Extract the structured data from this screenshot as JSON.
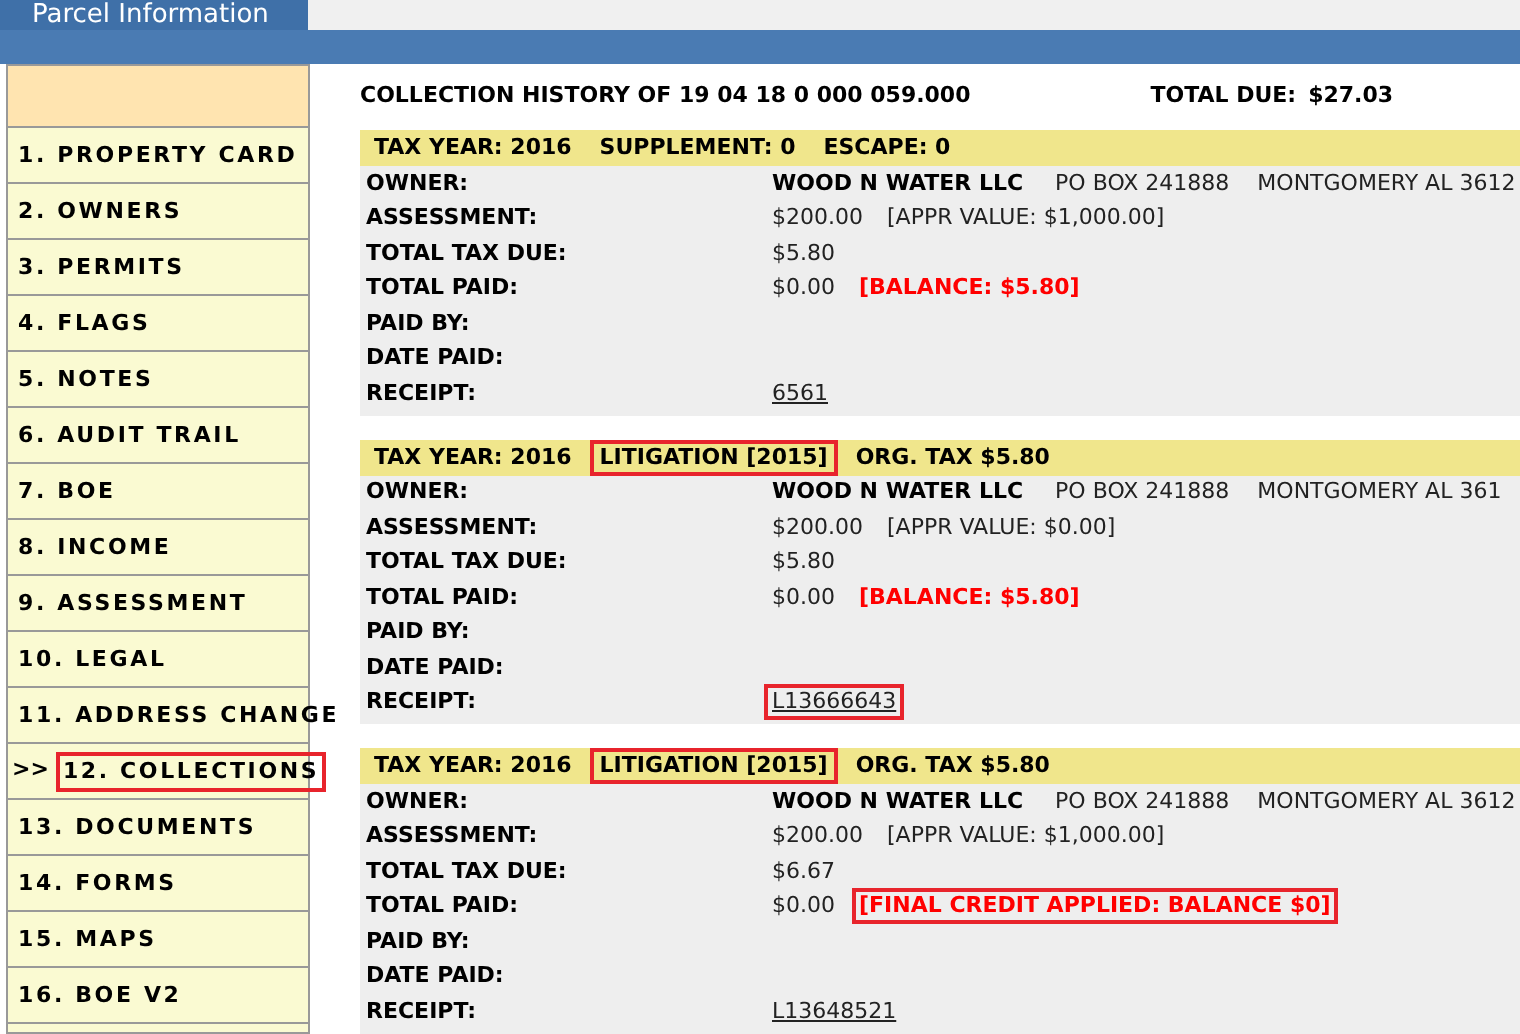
{
  "tab": {
    "label": "Parcel Information"
  },
  "sidebar": {
    "pointer": ">>",
    "items": [
      {
        "label": "1. PROPERTY CARD",
        "selected": false,
        "highlighted": false
      },
      {
        "label": "2. OWNERS",
        "selected": false,
        "highlighted": false
      },
      {
        "label": "3. PERMITS",
        "selected": false,
        "highlighted": false
      },
      {
        "label": "4. FLAGS",
        "selected": false,
        "highlighted": false
      },
      {
        "label": "5. NOTES",
        "selected": false,
        "highlighted": false
      },
      {
        "label": "6. AUDIT TRAIL",
        "selected": false,
        "highlighted": false
      },
      {
        "label": "7. BOE",
        "selected": false,
        "highlighted": false
      },
      {
        "label": "8. INCOME",
        "selected": false,
        "highlighted": false
      },
      {
        "label": "9. ASSESSMENT",
        "selected": false,
        "highlighted": false
      },
      {
        "label": "10. LEGAL",
        "selected": false,
        "highlighted": false
      },
      {
        "label": "11. ADDRESS CHANGE",
        "selected": false,
        "highlighted": false
      },
      {
        "label": "12. COLLECTIONS",
        "selected": true,
        "highlighted": true
      },
      {
        "label": "13. DOCUMENTS",
        "selected": false,
        "highlighted": false
      },
      {
        "label": "14. FORMS",
        "selected": false,
        "highlighted": false
      },
      {
        "label": "15. MAPS",
        "selected": false,
        "highlighted": false
      },
      {
        "label": "16. BOE V2",
        "selected": false,
        "highlighted": false
      }
    ]
  },
  "heading": {
    "title": "COLLECTION HISTORY OF 19 04 18 0 000 059.000",
    "total_label": "TOTAL DUE:",
    "total": "$27.03"
  },
  "records": [
    {
      "header": [
        {
          "text": "TAX YEAR: 2016",
          "highlighted": false
        },
        {
          "text": "SUPPLEMENT: 0",
          "highlighted": false
        },
        {
          "text": "ESCAPE: 0",
          "highlighted": false
        }
      ],
      "rows": [
        {
          "label": "OWNER:",
          "values": [
            {
              "text": "WOOD N WATER LLC",
              "kind": "bold",
              "highlighted": false
            },
            {
              "text": "PO BOX 241888",
              "kind": "plain",
              "highlighted": false
            },
            {
              "text": "MONTGOMERY AL 3612",
              "kind": "plain",
              "highlighted": false
            }
          ]
        },
        {
          "label": "ASSESSMENT:",
          "values": [
            {
              "text": "$200.00",
              "kind": "plain",
              "highlighted": false
            },
            {
              "text": "[APPR VALUE: $1,000.00]",
              "kind": "plain",
              "highlighted": false
            }
          ]
        },
        {
          "label": "TOTAL TAX DUE:",
          "values": [
            {
              "text": "$5.80",
              "kind": "plain",
              "highlighted": false
            }
          ]
        },
        {
          "label": "TOTAL PAID:",
          "values": [
            {
              "text": "$0.00",
              "kind": "plain",
              "highlighted": false
            },
            {
              "text": "[BALANCE: $5.80]",
              "kind": "alert",
              "highlighted": false
            }
          ]
        },
        {
          "label": "PAID BY:",
          "values": []
        },
        {
          "label": "DATE PAID:",
          "values": []
        },
        {
          "label": "RECEIPT:",
          "values": [
            {
              "text": "6561",
              "kind": "link",
              "highlighted": false
            }
          ]
        }
      ]
    },
    {
      "header": [
        {
          "text": "TAX YEAR: 2016",
          "highlighted": false
        },
        {
          "text": "LITIGATION [2015]",
          "highlighted": true
        },
        {
          "text": "ORG. TAX $5.80",
          "highlighted": false
        }
      ],
      "rows": [
        {
          "label": "OWNER:",
          "values": [
            {
              "text": "WOOD N WATER LLC",
              "kind": "bold",
              "highlighted": false
            },
            {
              "text": "PO BOX 241888",
              "kind": "plain",
              "highlighted": false
            },
            {
              "text": "MONTGOMERY AL 361",
              "kind": "plain",
              "highlighted": false
            }
          ]
        },
        {
          "label": "ASSESSMENT:",
          "values": [
            {
              "text": "$200.00",
              "kind": "plain",
              "highlighted": false
            },
            {
              "text": "[APPR VALUE: $0.00]",
              "kind": "plain",
              "highlighted": false
            }
          ]
        },
        {
          "label": "TOTAL TAX DUE:",
          "values": [
            {
              "text": "$5.80",
              "kind": "plain",
              "highlighted": false
            }
          ]
        },
        {
          "label": "TOTAL PAID:",
          "values": [
            {
              "text": "$0.00",
              "kind": "plain",
              "highlighted": false
            },
            {
              "text": "[BALANCE: $5.80]",
              "kind": "alert",
              "highlighted": false
            }
          ]
        },
        {
          "label": "PAID BY:",
          "values": []
        },
        {
          "label": "DATE PAID:",
          "values": []
        },
        {
          "label": "RECEIPT:",
          "values": [
            {
              "text": "L13666643",
              "kind": "link",
              "highlighted": true
            }
          ]
        }
      ]
    },
    {
      "header": [
        {
          "text": "TAX YEAR: 2016",
          "highlighted": false
        },
        {
          "text": "LITIGATION [2015]",
          "highlighted": true
        },
        {
          "text": "ORG. TAX $5.80",
          "highlighted": false
        }
      ],
      "rows": [
        {
          "label": "OWNER:",
          "values": [
            {
              "text": "WOOD N WATER LLC",
              "kind": "bold",
              "highlighted": false
            },
            {
              "text": "PO BOX 241888",
              "kind": "plain",
              "highlighted": false
            },
            {
              "text": "MONTGOMERY AL 3612",
              "kind": "plain",
              "highlighted": false
            }
          ]
        },
        {
          "label": "ASSESSMENT:",
          "values": [
            {
              "text": "$200.00",
              "kind": "plain",
              "highlighted": false
            },
            {
              "text": "[APPR VALUE: $1,000.00]",
              "kind": "plain",
              "highlighted": false
            }
          ]
        },
        {
          "label": "TOTAL TAX DUE:",
          "values": [
            {
              "text": "$6.67",
              "kind": "plain",
              "highlighted": false
            }
          ]
        },
        {
          "label": "TOTAL PAID:",
          "values": [
            {
              "text": "$0.00",
              "kind": "plain",
              "highlighted": false
            },
            {
              "text": "[FINAL CREDIT APPLIED: BALANCE $0]",
              "kind": "alert",
              "highlighted": true
            }
          ]
        },
        {
          "label": "PAID BY:",
          "values": []
        },
        {
          "label": "DATE PAID:",
          "values": []
        },
        {
          "label": "RECEIPT:",
          "values": [
            {
              "text": "L13648521",
              "kind": "link",
              "highlighted": false
            }
          ]
        }
      ]
    }
  ]
}
